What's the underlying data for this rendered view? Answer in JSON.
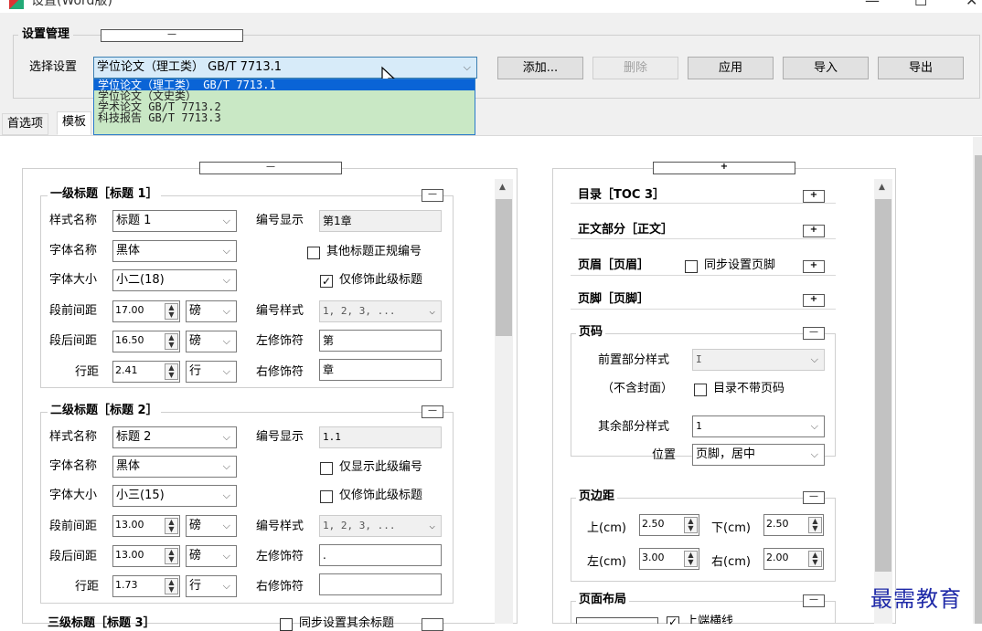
{
  "window": {
    "title": "设置(Word版)",
    "minimize": "—",
    "maximize": "☐",
    "close": "✕"
  },
  "management": {
    "group_label": "设置管理",
    "collapse": "—",
    "select_label": "选择设置",
    "selected": "学位论文（理工类） GB/T 7713.1",
    "options": [
      "学位论文（理工类） GB/T 7713.1",
      "学位论文（文史类）",
      "学术论文 GB/T 7713.2",
      "科技报告 GB/T 7713.3"
    ],
    "buttons": {
      "add": "添加...",
      "delete": "删除",
      "apply": "应用",
      "import": "导入",
      "export": "导出"
    }
  },
  "tabs": [
    "首选项",
    "模板"
  ],
  "left_panel": {
    "collapse": "—",
    "h1": {
      "title": "一级标题［标题 1］",
      "collapse": "—",
      "style_label": "样式名称",
      "style": "标题 1",
      "num_display_label": "编号显示",
      "num_display": "第1章",
      "font_label": "字体名称",
      "font": "黑体",
      "check1": "其他标题正规编号",
      "check1_on": false,
      "size_label": "字体大小",
      "size": "小二(18)",
      "check2": "仅修饰此级标题",
      "check2_on": true,
      "before_label": "段前间距",
      "before": "17.00",
      "before_unit": "磅",
      "num_style_label": "编号样式",
      "num_style": "1, 2, 3, ...",
      "after_label": "段后间距",
      "after": "16.50",
      "after_unit": "磅",
      "left_dec_label": "左修饰符",
      "left_dec": "第",
      "line_label": "行距",
      "line": "2.41",
      "line_unit": "行",
      "right_dec_label": "右修饰符",
      "right_dec": "章"
    },
    "h2": {
      "title": "二级标题［标题 2］",
      "collapse": "—",
      "style_label": "样式名称",
      "style": "标题 2",
      "num_display_label": "编号显示",
      "num_display": "1.1",
      "font_label": "字体名称",
      "font": "黑体",
      "check1": "仅显示此级编号",
      "check1_on": false,
      "size_label": "字体大小",
      "size": "小三(15)",
      "check2": "仅修饰此级标题",
      "check2_on": false,
      "before_label": "段前间距",
      "before": "13.00",
      "before_unit": "磅",
      "num_style_label": "编号样式",
      "num_style": "1, 2, 3, ...",
      "after_label": "段后间距",
      "after": "13.00",
      "after_unit": "磅",
      "left_dec_label": "左修饰符",
      "left_dec": ".",
      "line_label": "行距",
      "line": "1.73",
      "line_unit": "行",
      "right_dec_label": "右修饰符",
      "right_dec": ""
    },
    "h3": {
      "title": "三级标题［标题 3］",
      "check": "同步设置其余标题"
    }
  },
  "right_panel": {
    "expand": "+",
    "toc": {
      "title": "目录［TOC 3］",
      "toggle": "+"
    },
    "body": {
      "title": "正文部分［正文］",
      "toggle": "+"
    },
    "header": {
      "title": "页眉［页眉］",
      "check": "同步设置页脚",
      "toggle": "+"
    },
    "footer": {
      "title": "页脚［页脚］",
      "toggle": "+"
    },
    "pagenum": {
      "title": "页码",
      "toggle": "—",
      "front_label": "前置部分样式",
      "front": "I",
      "cover_note": "（不含封面）",
      "toc_check": "目录不带页码",
      "rest_label": "其余部分样式",
      "rest": "1",
      "pos_label": "位置",
      "pos": "页脚，居中"
    },
    "margins": {
      "title": "页边距",
      "toggle": "—",
      "top_label": "上(cm)",
      "top": "2.50",
      "bottom_label": "下(cm)",
      "bottom": "2.50",
      "left_label": "左(cm)",
      "left": "3.00",
      "right_label": "右(cm)",
      "right": "2.00"
    },
    "layout": {
      "title": "页面布局",
      "toggle": "—",
      "check": "上端横线"
    }
  },
  "watermark": "最需教育"
}
